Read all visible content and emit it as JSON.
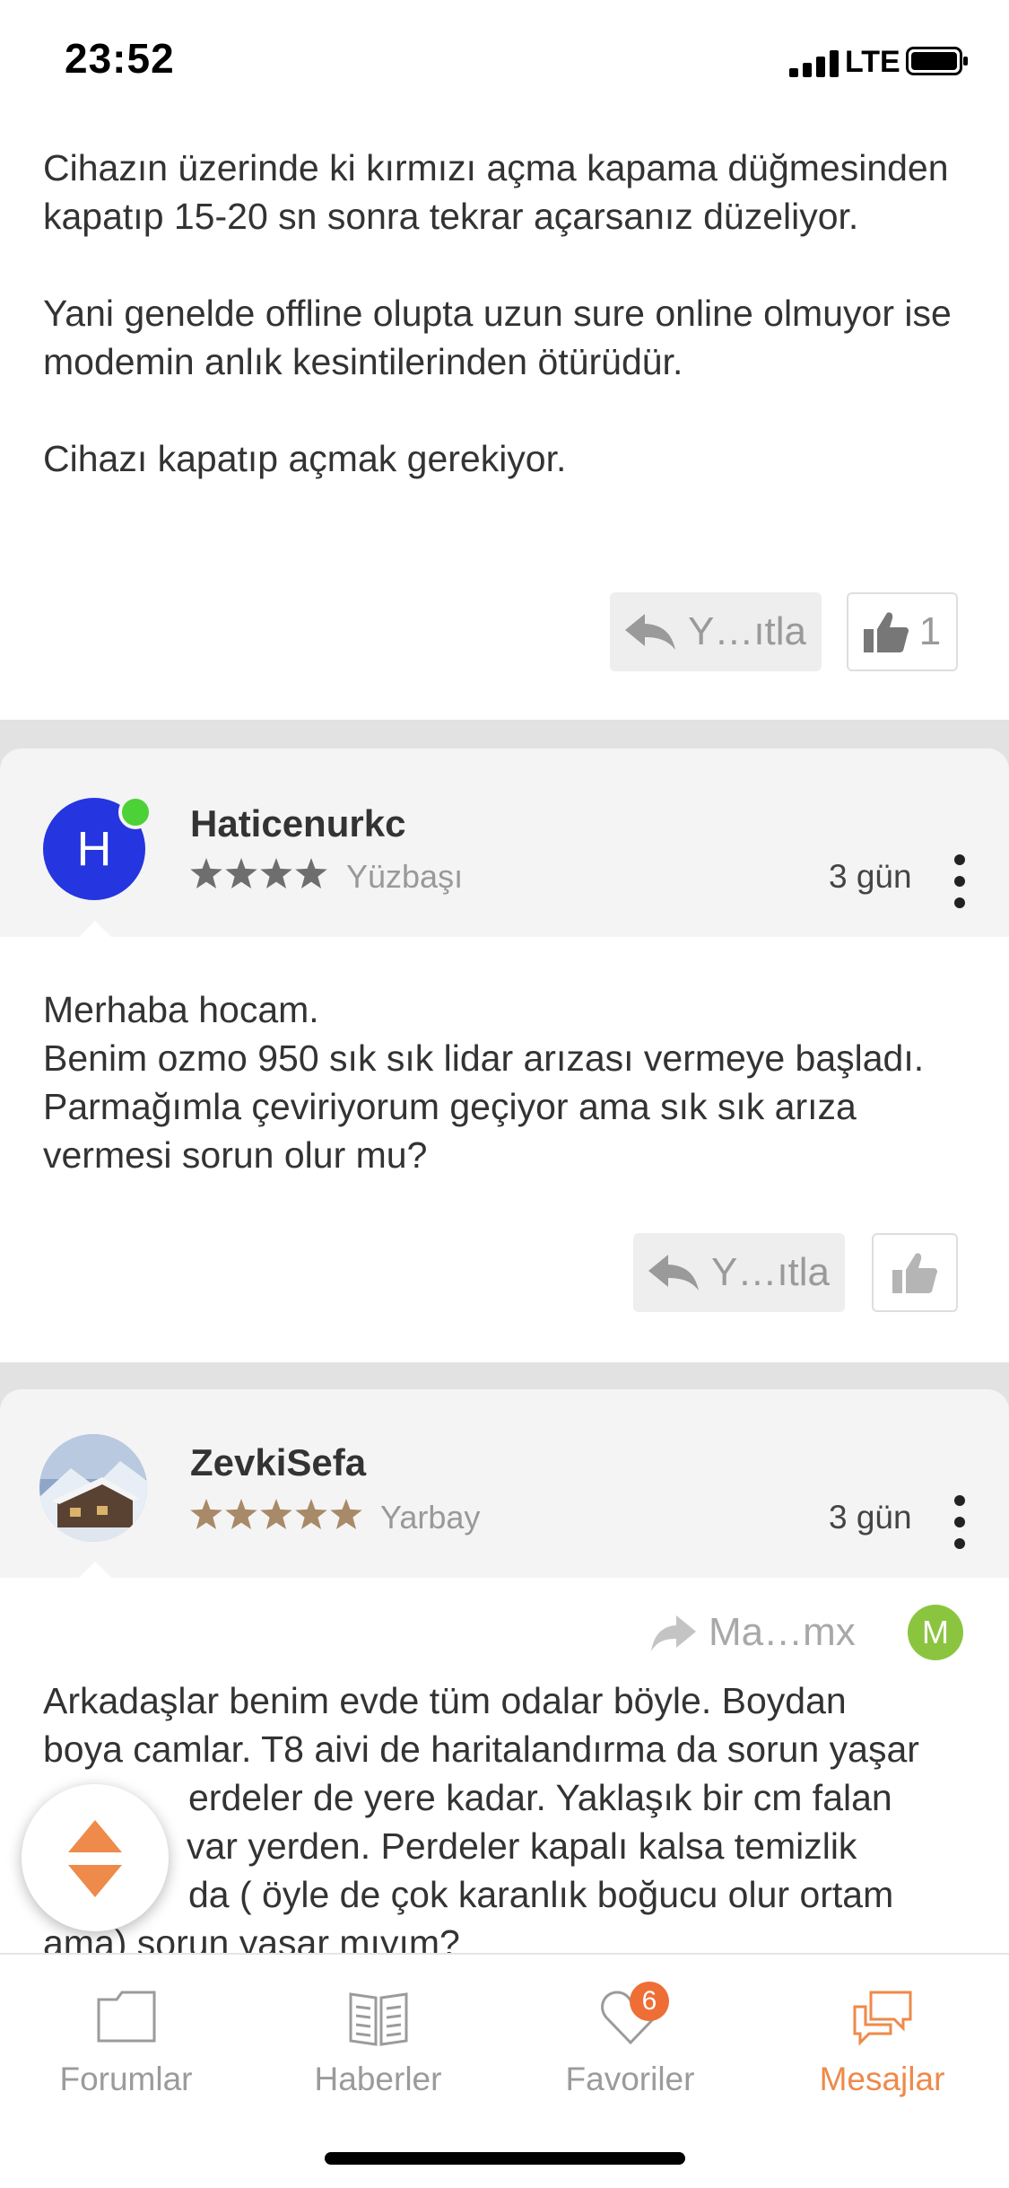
{
  "status_bar": {
    "time": "23:52",
    "network": "LTE"
  },
  "post1": {
    "text": "Cihazın üzerinde ki kırmızı açma kapama düğmesinden kapatıp 15-20 sn sonra tekrar açarsanız düzeliyor.\n\nYani genelde offline olupta uzun sure online olmuyor ise modemin anlık kesintilerinden ötürüdür.\n\nCihazı kapatıp açmak gerekiyor.",
    "reply_label": "Y…ıtla",
    "like_count": "1"
  },
  "post2": {
    "avatar_letter": "H",
    "username": "Haticenurkc",
    "rank": "Yüzbaşı",
    "date": "3 gün",
    "text": "Merhaba hocam.\nBenim ozmo 950 sık sık lidar arızası vermeye başladı. Parmağımla çeviriyorum geçiyor ama sık sık arıza vermesi sorun olur mu?",
    "reply_label": "Y…ıtla"
  },
  "post3": {
    "username": "ZevkiSefa",
    "rank": "Yarbay",
    "date": "3 gün",
    "forwarded_to": "Ma…mx",
    "forwarded_avatar_letter": "M",
    "text_line1": "Arkadaşlar benim evde tüm odalar böyle. Boydan",
    "text_line2": "boya camlar. T8 aivi de haritalandırma da sorun yaşar",
    "text_line3": "erdeler de yere kadar. Yaklaşık bir cm falan",
    "text_line4": "var yerden. Perdeler kapalı kalsa temizlik",
    "text_line5": "da ( öyle de çok karanlık boğucu olur ortam",
    "text_line6": "ama) sorun yaşar mıyım?"
  },
  "tabs": [
    {
      "label": "Forumlar",
      "icon": "folder-icon"
    },
    {
      "label": "Haberler",
      "icon": "newspaper-icon"
    },
    {
      "label": "Favoriler",
      "icon": "heart-icon",
      "badge": "6"
    },
    {
      "label": "Mesajlar",
      "icon": "chat-bubbles-icon",
      "active": true
    }
  ],
  "colors": {
    "accent": "#ee8a4a",
    "avatar_h": "#2535e0",
    "online": "#4cd137",
    "avatar_m": "#8bc53f",
    "stars_rank1": "#6e6e6e",
    "stars_rank2": "#a88a68"
  }
}
